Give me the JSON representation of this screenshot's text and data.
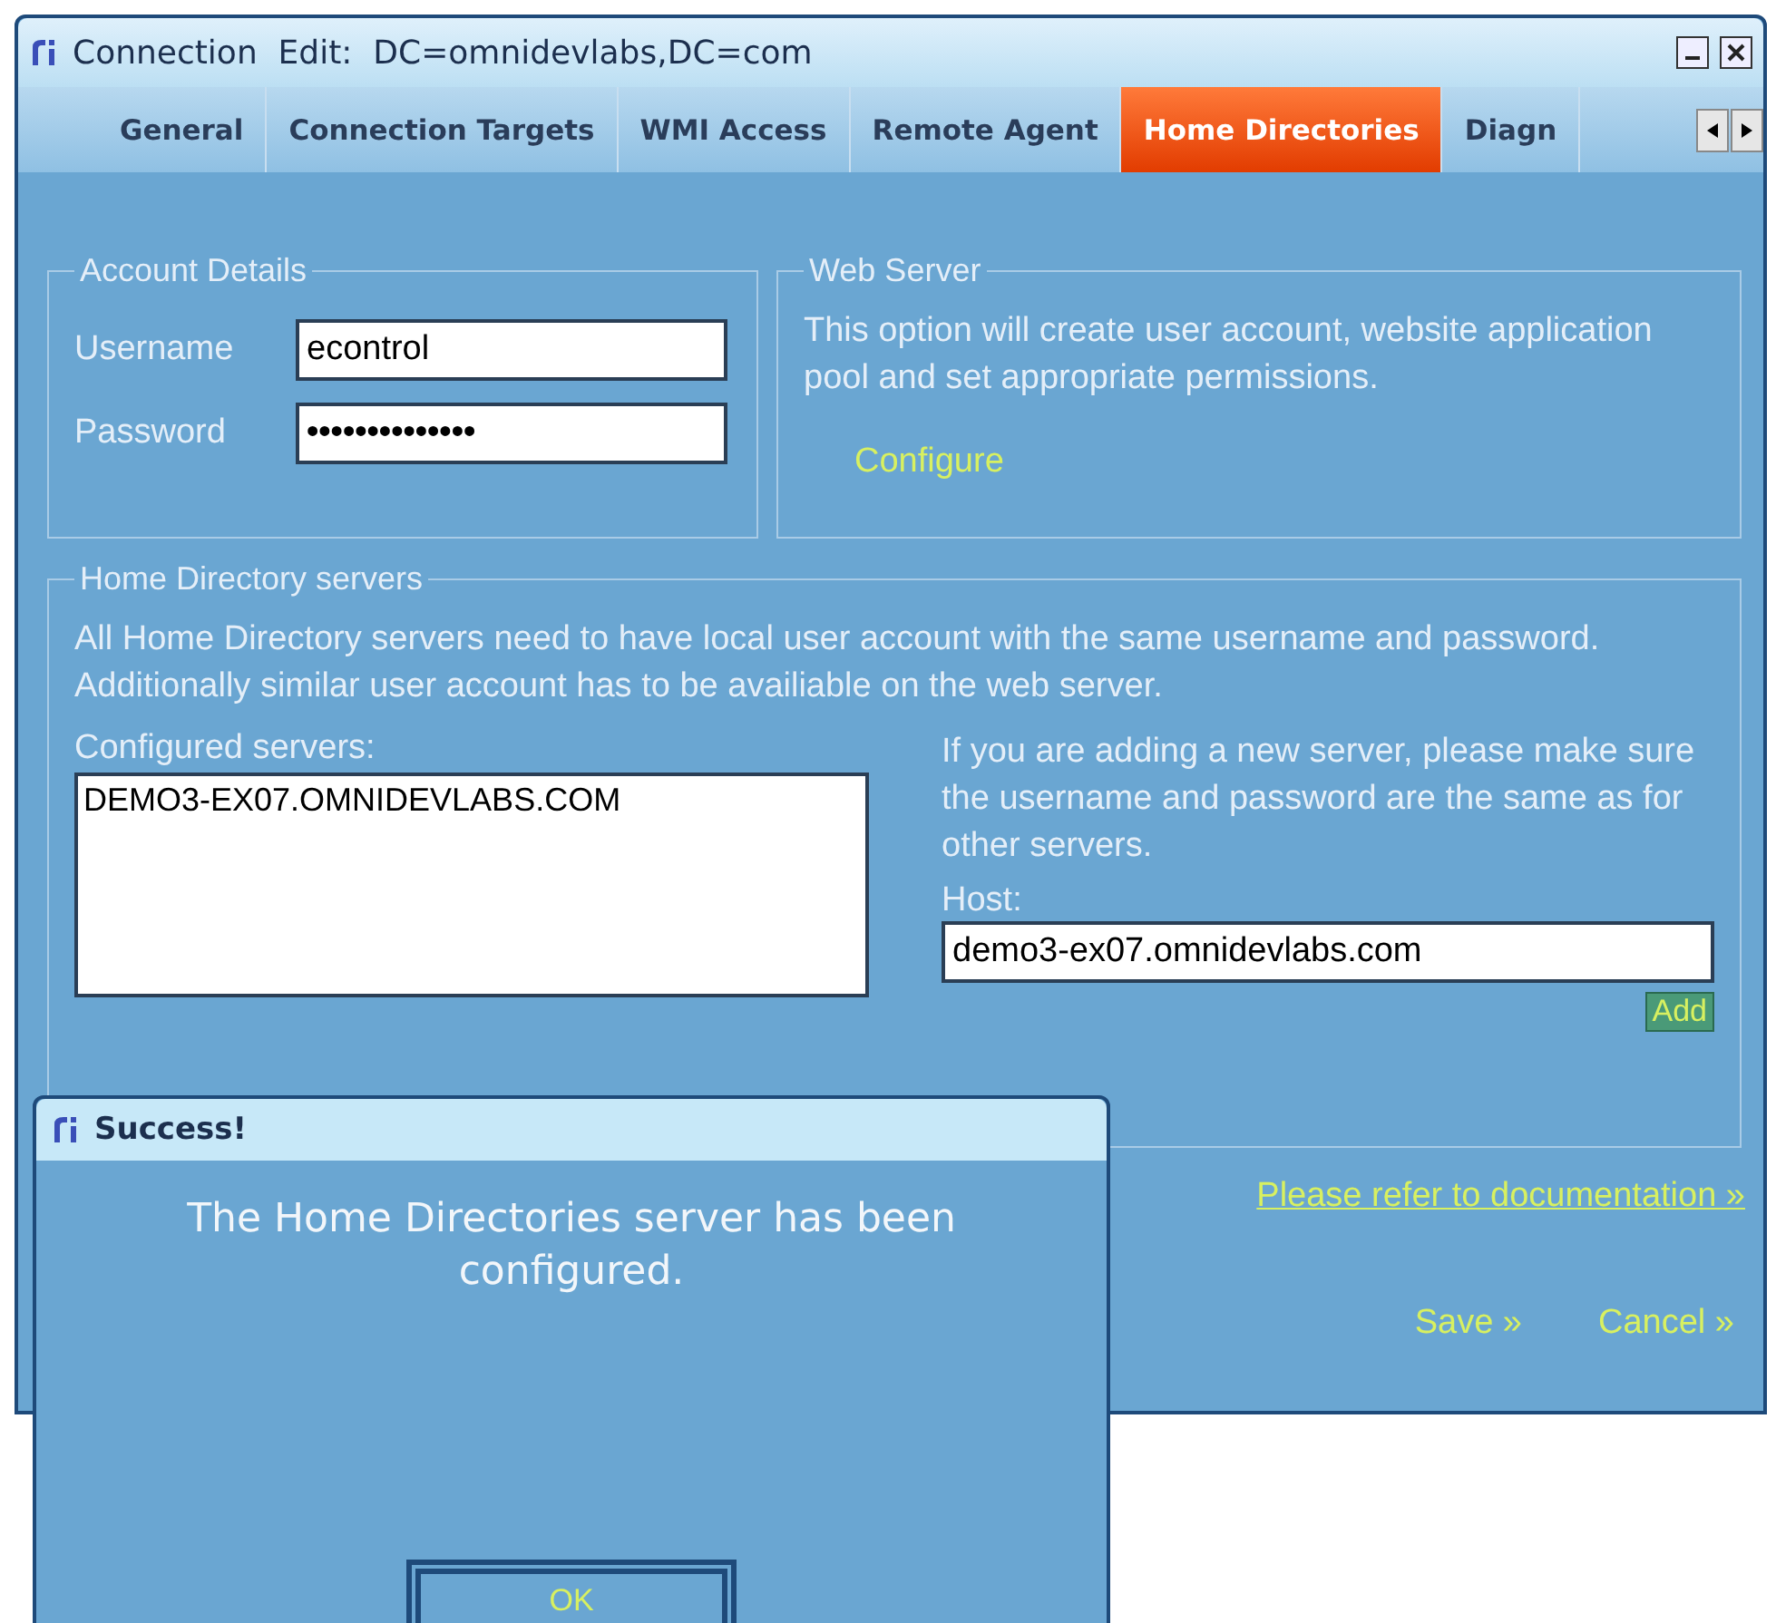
{
  "window": {
    "title": "Connection  Edit:  DC=omnidevlabs,DC=com"
  },
  "tabs": [
    {
      "label": "General",
      "selected": false
    },
    {
      "label": "Connection Targets",
      "selected": false
    },
    {
      "label": "WMI Access",
      "selected": false
    },
    {
      "label": "Remote Agent",
      "selected": false
    },
    {
      "label": "Home Directories",
      "selected": true
    },
    {
      "label": "Diagn",
      "selected": false
    }
  ],
  "account_details": {
    "title": "Account Details",
    "username": {
      "label": "Username",
      "value": "econtrol"
    },
    "password": {
      "label": "Password",
      "value": "••••••••••••••"
    }
  },
  "web_server": {
    "title": "Web Server",
    "description": "This option will create user account, website application pool and set appropriate permissions.",
    "configure_link": "Configure"
  },
  "home_directory_servers": {
    "title": "Home Directory servers",
    "description": "All Home Directory servers need to have local user account with the same username and password. Additionally similar user account has to be availiable on the web server.",
    "list_label": "Configured servers:",
    "servers": [
      "DEMO3-EX07.OMNIDEVLABS.COM"
    ],
    "hint": "If you are adding a new server, please make sure the username and password are the same as for other servers.",
    "host": {
      "label": "Host:",
      "value": "demo3-ex07.omnidevlabs.com"
    },
    "add_button": "Add"
  },
  "documentation_link": "Please refer to documentation »",
  "actions": [
    "Save »",
    "Cancel »"
  ],
  "dialog": {
    "title": "Success!",
    "message": "The Home Directories server has been configured.",
    "button": "OK"
  }
}
